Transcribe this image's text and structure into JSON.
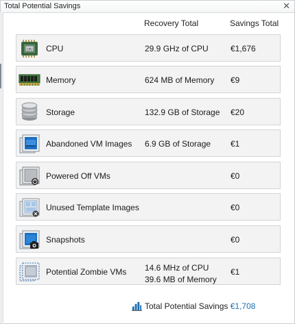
{
  "window": {
    "title": "Total Potential Savings",
    "close_glyph": "✕"
  },
  "columns": {
    "recovery": "Recovery Total",
    "savings": "Savings Total"
  },
  "rows": [
    {
      "id": "cpu",
      "icon": "cpu-chip-icon",
      "name": "CPU",
      "recovery": "29.9 GHz of CPU",
      "savings": "€1,676"
    },
    {
      "id": "memory",
      "icon": "memory-module-icon",
      "name": "Memory",
      "recovery": "624 MB of Memory",
      "savings": "€9"
    },
    {
      "id": "storage",
      "icon": "storage-disk-icon",
      "name": "Storage",
      "recovery": "132.9 GB of Storage",
      "savings": "€20"
    },
    {
      "id": "abandoned-vm-images",
      "icon": "vm-image-icon",
      "name": "Abandoned VM Images",
      "recovery": "6.9 GB of Storage",
      "savings": "€1"
    },
    {
      "id": "powered-off-vms",
      "icon": "powered-off-vm-icon",
      "name": "Powered Off VMs",
      "recovery": "",
      "savings": "€0"
    },
    {
      "id": "unused-template-images",
      "icon": "template-image-icon",
      "name": "Unused Template Images",
      "recovery": "",
      "savings": "€0"
    },
    {
      "id": "snapshots",
      "icon": "snapshot-camera-icon",
      "name": "Snapshots",
      "recovery": "",
      "savings": "€0"
    },
    {
      "id": "potential-zombie-vms",
      "icon": "zombie-vm-icon",
      "name": "Potential Zombie VMs",
      "recovery": "14.6 MHz of CPU",
      "recovery_line2": "39.6 MB of Memory",
      "savings": "€1"
    }
  ],
  "total": {
    "icon": "bar-chart-icon",
    "label": "Total Potential Savings",
    "value": "€1,708"
  },
  "colors": {
    "accent": "#1f6fb0",
    "row_bg": "#f3f3f3",
    "row_border": "#d2d4d6"
  }
}
